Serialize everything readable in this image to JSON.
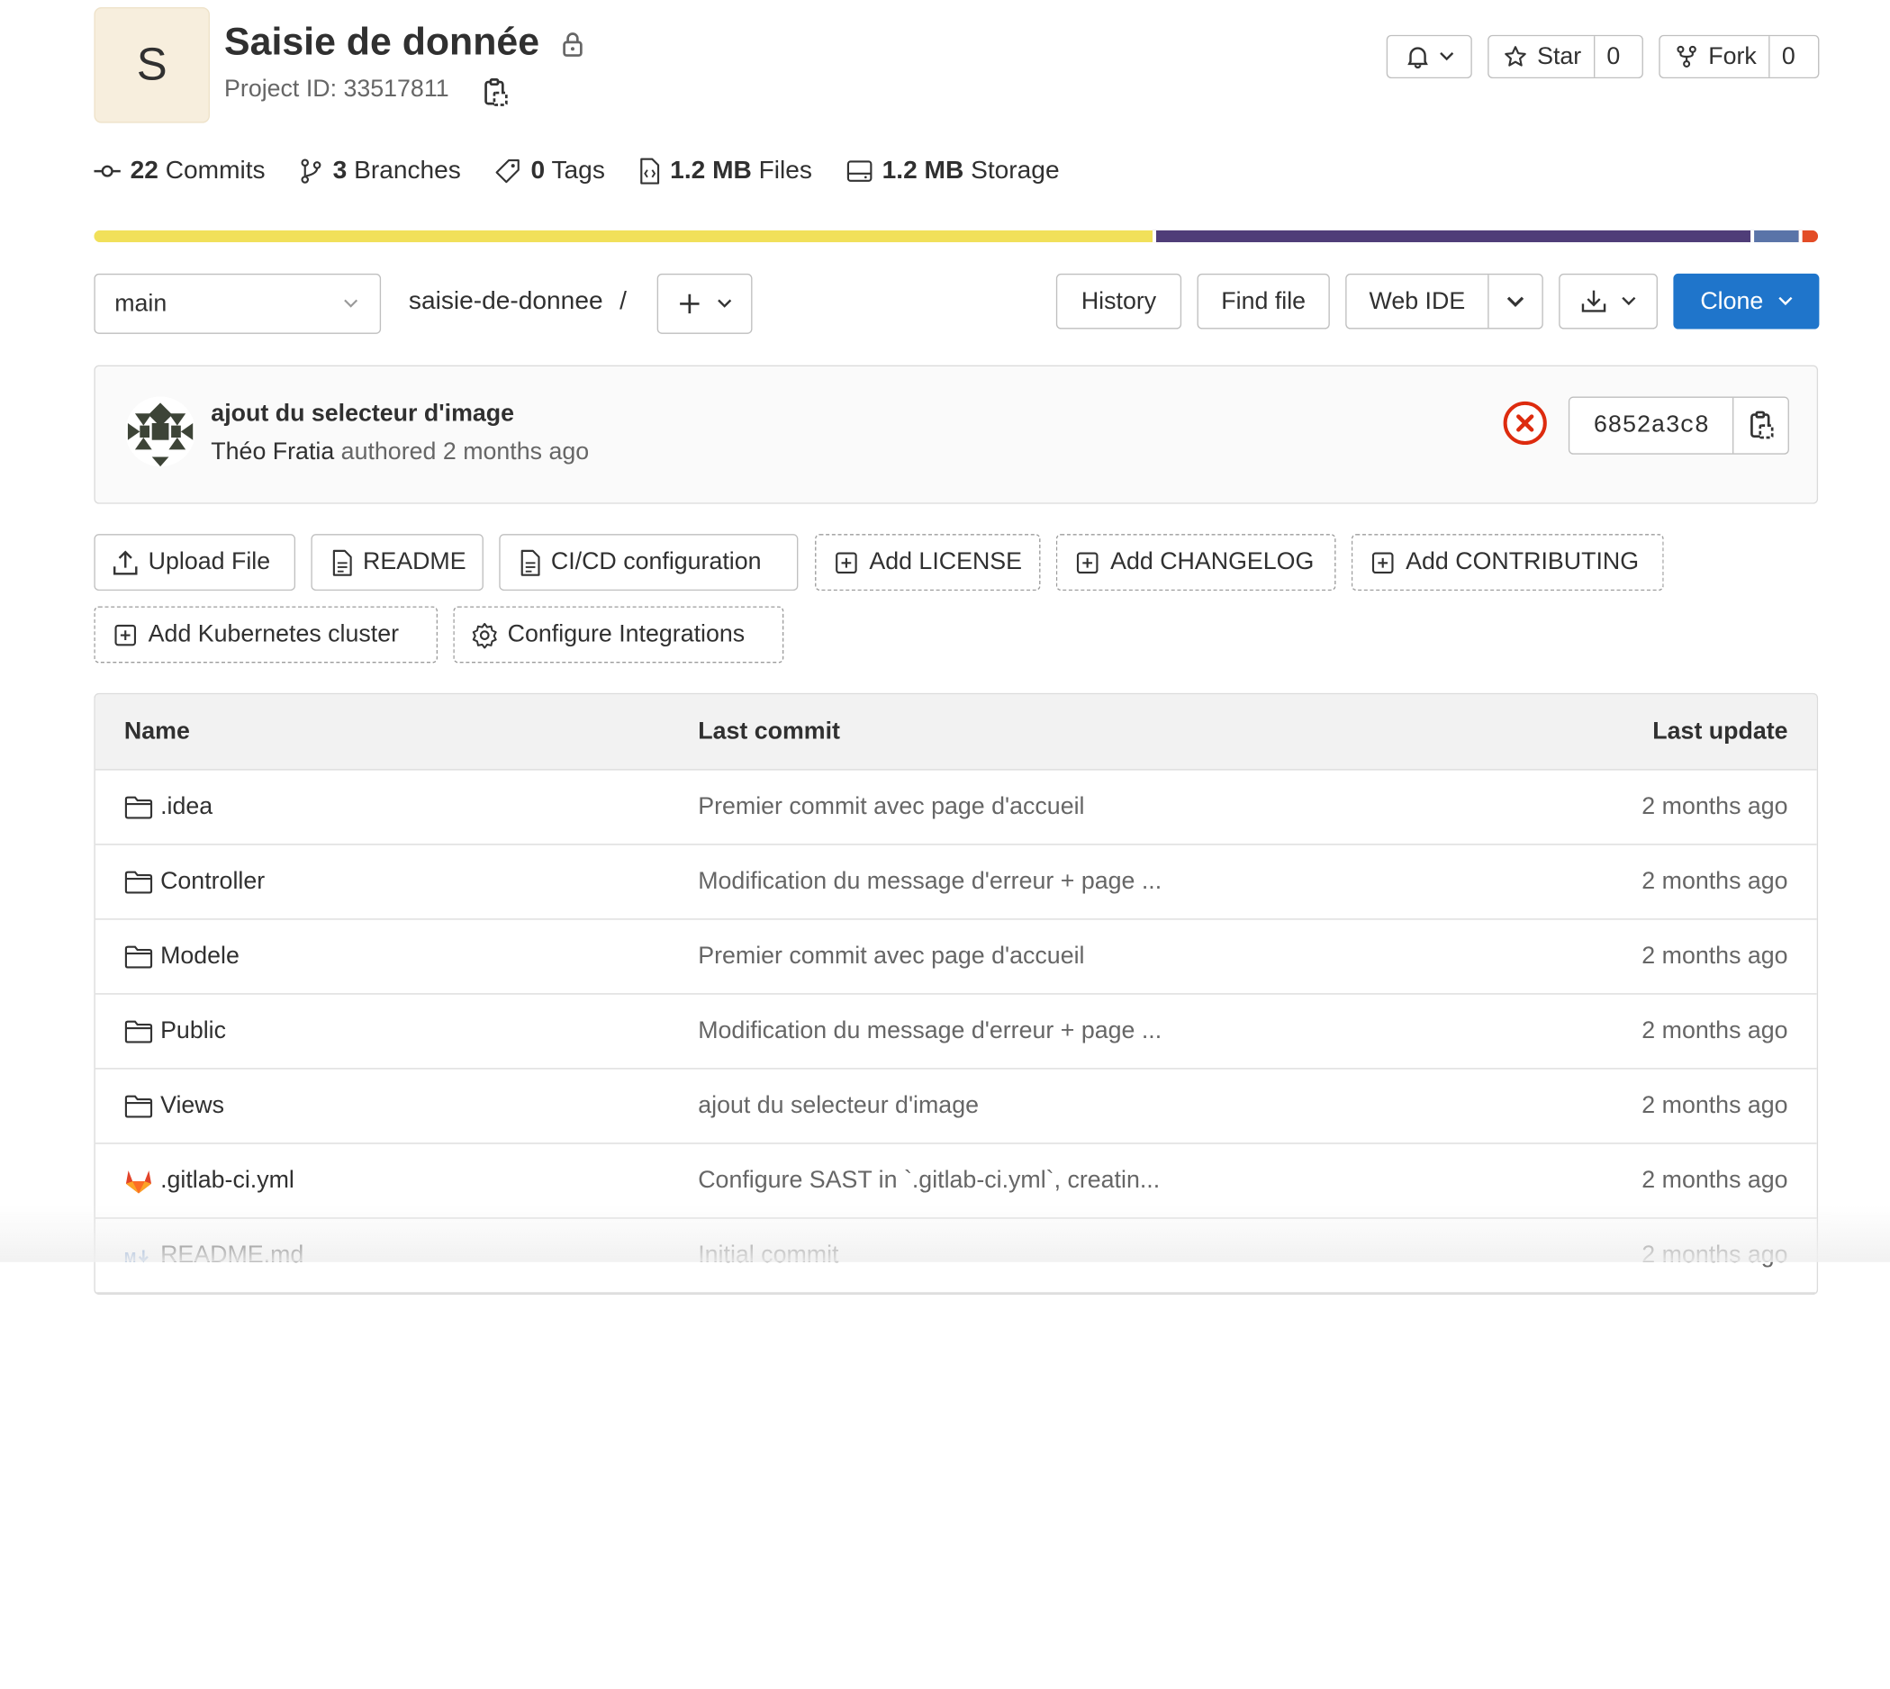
{
  "project": {
    "avatar_letter": "S",
    "title": "Saisie de donnée",
    "project_id": "Project ID: 33517811"
  },
  "header_buttons": {
    "star_label": "Star",
    "star_count": "0",
    "fork_label": "Fork",
    "fork_count": "0"
  },
  "stats": {
    "commits_n": "22",
    "commits_label": "Commits",
    "branches_n": "3",
    "branches_label": "Branches",
    "tags_n": "0",
    "tags_label": "Tags",
    "files_n": "1.2 MB",
    "files_label": "Files",
    "storage_n": "1.2 MB",
    "storage_label": "Storage"
  },
  "language_bar": [
    {
      "color": "#f1e05a",
      "fraction": 0.618
    },
    {
      "color": "#4f3d78",
      "fraction": 0.347
    },
    {
      "color": "#5a74a8",
      "fraction": 0.026
    },
    {
      "color": "#e34c26",
      "fraction": 0.009
    }
  ],
  "repo": {
    "branch": "main",
    "path": "saisie-de-donnee",
    "path_sep": "/",
    "history": "History",
    "find_file": "Find file",
    "web_ide": "Web IDE",
    "clone": "Clone"
  },
  "last_commit": {
    "title": "ajout du selecteur d'image",
    "author": "Théo Fratia",
    "authored": "authored",
    "time": "2 months ago",
    "sha": "6852a3c8"
  },
  "actions": {
    "upload": "Upload File",
    "readme": "README",
    "cicd": "CI/CD configuration",
    "license": "Add LICENSE",
    "changelog": "Add CHANGELOG",
    "contributing": "Add CONTRIBUTING",
    "kubernetes": "Add Kubernetes cluster",
    "integrations": "Configure Integrations"
  },
  "table": {
    "headers": {
      "name": "Name",
      "last_commit": "Last commit",
      "last_update": "Last update"
    },
    "rows": [
      {
        "name": ".idea",
        "commit": "Premier commit avec page d'accueil",
        "updated": "2 months ago",
        "icon": "folder-icon"
      },
      {
        "name": "Controller",
        "commit": "Modification du message d'erreur + page ...",
        "updated": "2 months ago",
        "icon": "folder-icon"
      },
      {
        "name": "Modele",
        "commit": "Premier commit avec page d'accueil",
        "updated": "2 months ago",
        "icon": "folder-icon"
      },
      {
        "name": "Public",
        "commit": "Modification du message d'erreur + page ...",
        "updated": "2 months ago",
        "icon": "folder-icon"
      },
      {
        "name": "Views",
        "commit": "ajout du selecteur d'image",
        "updated": "2 months ago",
        "icon": "folder-icon"
      },
      {
        "name": ".gitlab-ci.yml",
        "commit": "Configure SAST in `.gitlab-ci.yml`, creatin...",
        "updated": "2 months ago",
        "icon": "gitlab-icon"
      },
      {
        "name": "README.md",
        "commit": "Initial commit",
        "updated": "2 months ago",
        "icon": "markdown-icon"
      }
    ]
  },
  "colors": {
    "clone_button": "#1f75cb",
    "pipeline_failed": "#dd2b0e"
  }
}
